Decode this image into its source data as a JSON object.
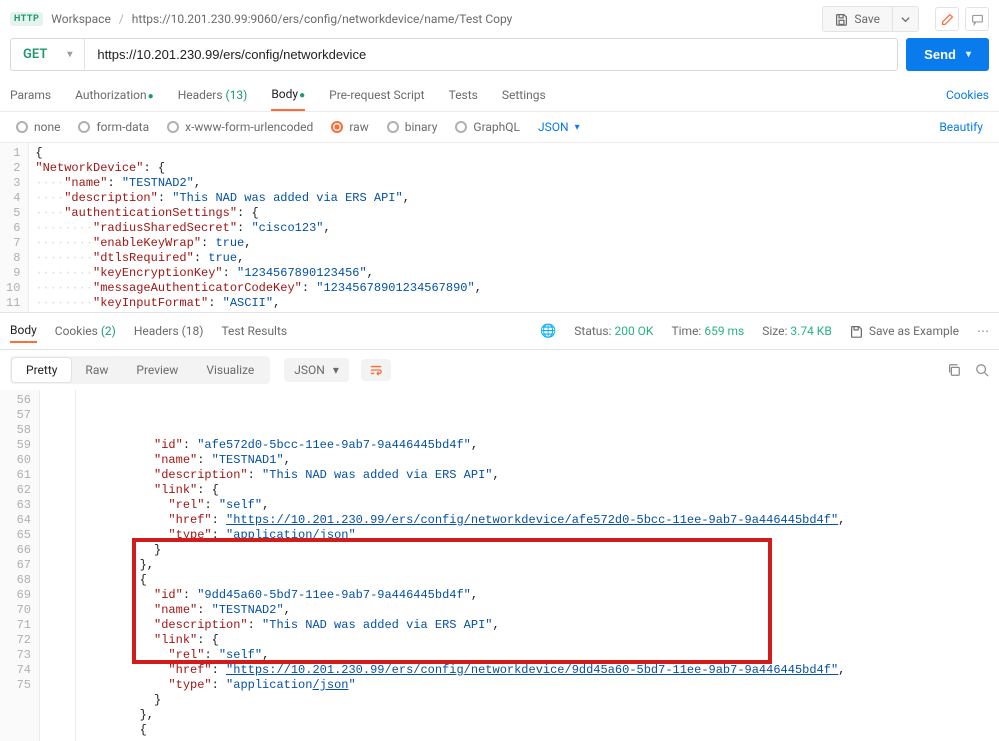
{
  "breadcrumb": {
    "workspace": "Workspace",
    "title": "https://10.201.230.99:9060/ers/config/networkdevice/name/Test Copy"
  },
  "save_button": {
    "label": "Save"
  },
  "request": {
    "method": "GET",
    "url": "https://10.201.230.99/ers/config/networkdevice"
  },
  "send_button": {
    "label": "Send"
  },
  "req_tabs": {
    "params": "Params",
    "auth": "Authorization",
    "headers": "Headers",
    "headers_count": "(13)",
    "body": "Body",
    "prereq": "Pre-request Script",
    "tests": "Tests",
    "settings": "Settings",
    "cookies": "Cookies"
  },
  "body_types": {
    "none": "none",
    "form_data": "form-data",
    "x_www": "x-www-form-urlencoded",
    "raw": "raw",
    "binary": "binary",
    "graphql": "GraphQL",
    "lang": "JSON",
    "beautify": "Beautify"
  },
  "request_body_lines": [
    "{",
    "\"NetworkDevice\": {",
    "····\"name\": \"TESTNAD2\",",
    "····\"description\": \"This NAD was added via ERS API\",",
    "····\"authenticationSettings\": {",
    "········\"radiusSharedSecret\": \"cisco123\",",
    "········\"enableKeyWrap\": true,",
    "········\"dtlsRequired\": true,",
    "········\"keyEncryptionKey\": \"1234567890123456\",",
    "········\"messageAuthenticatorCodeKey\": \"12345678901234567890\",",
    "········\"keyInputFormat\": \"ASCII\","
  ],
  "response_status": {
    "status_label": "Status:",
    "status_value": "200 OK",
    "time_label": "Time:",
    "time_value": "659 ms",
    "size_label": "Size:",
    "size_value": "3.74 KB",
    "save_example": "Save as Example"
  },
  "resp_tabs": {
    "body": "Body",
    "cookies": "Cookies",
    "cookies_count": "(2)",
    "headers": "Headers",
    "headers_count": "(18)",
    "tests": "Test Results"
  },
  "view_modes": {
    "pretty": "Pretty",
    "raw": "Raw",
    "preview": "Preview",
    "visualize": "Visualize",
    "lang": "JSON"
  },
  "response_lines": {
    "start": 56,
    "lines": [
      {
        "indent": 10,
        "parts": [
          [
            "key",
            "\"id\""
          ],
          [
            "punc",
            ": "
          ],
          [
            "str",
            "\"afe572d0-5bcc-11ee-9ab7-9a446445bd4f\""
          ],
          [
            "punc",
            ","
          ]
        ]
      },
      {
        "indent": 10,
        "parts": [
          [
            "key",
            "\"name\""
          ],
          [
            "punc",
            ": "
          ],
          [
            "str",
            "\"TESTNAD1\""
          ],
          [
            "punc",
            ","
          ]
        ]
      },
      {
        "indent": 10,
        "parts": [
          [
            "key",
            "\"description\""
          ],
          [
            "punc",
            ": "
          ],
          [
            "str",
            "\"This NAD was added via ERS API\""
          ],
          [
            "punc",
            ","
          ]
        ]
      },
      {
        "indent": 10,
        "parts": [
          [
            "key",
            "\"link\""
          ],
          [
            "punc",
            ": {"
          ]
        ]
      },
      {
        "indent": 12,
        "parts": [
          [
            "key",
            "\"rel\""
          ],
          [
            "punc",
            ": "
          ],
          [
            "str",
            "\"self\""
          ],
          [
            "punc",
            ","
          ]
        ]
      },
      {
        "indent": 12,
        "parts": [
          [
            "key",
            "\"href\""
          ],
          [
            "punc",
            ": "
          ],
          [
            "strlink",
            "\"https://10.201.230.99/ers/config/networkdevice/afe572d0-5bcc-11ee-9ab7-9a446445bd4f\""
          ],
          [
            "punc",
            ","
          ]
        ]
      },
      {
        "indent": 12,
        "parts": [
          [
            "key",
            "\"type\""
          ],
          [
            "punc",
            ": "
          ],
          [
            "strpart",
            "\"application"
          ],
          [
            "strlink",
            "/json"
          ],
          [
            "strpart",
            "\""
          ]
        ]
      },
      {
        "indent": 10,
        "parts": [
          [
            "punc",
            "}"
          ]
        ]
      },
      {
        "indent": 8,
        "parts": [
          [
            "punc",
            "},"
          ]
        ]
      },
      {
        "indent": 8,
        "parts": [
          [
            "punc",
            "{"
          ]
        ]
      },
      {
        "indent": 10,
        "parts": [
          [
            "key",
            "\"id\""
          ],
          [
            "punc",
            ": "
          ],
          [
            "str",
            "\"9dd45a60-5bd7-11ee-9ab7-9a446445bd4f\""
          ],
          [
            "punc",
            ","
          ]
        ]
      },
      {
        "indent": 10,
        "parts": [
          [
            "key",
            "\"name\""
          ],
          [
            "punc",
            ": "
          ],
          [
            "str",
            "\"TESTNAD2\""
          ],
          [
            "punc",
            ","
          ]
        ]
      },
      {
        "indent": 10,
        "parts": [
          [
            "key",
            "\"description\""
          ],
          [
            "punc",
            ": "
          ],
          [
            "str",
            "\"This NAD was added via ERS API\""
          ],
          [
            "punc",
            ","
          ]
        ]
      },
      {
        "indent": 10,
        "parts": [
          [
            "key",
            "\"link\""
          ],
          [
            "punc",
            ": {"
          ]
        ]
      },
      {
        "indent": 12,
        "parts": [
          [
            "key",
            "\"rel\""
          ],
          [
            "punc",
            ": "
          ],
          [
            "str",
            "\"self\""
          ],
          [
            "punc",
            ","
          ]
        ]
      },
      {
        "indent": 12,
        "parts": [
          [
            "key",
            "\"href\""
          ],
          [
            "punc",
            ": "
          ],
          [
            "strlink",
            "\"https://10.201.230.99/ers/config/networkdevice/9dd45a60-5bd7-11ee-9ab7-9a446445bd4f\""
          ],
          [
            "punc",
            ","
          ]
        ]
      },
      {
        "indent": 12,
        "parts": [
          [
            "key",
            "\"type\""
          ],
          [
            "punc",
            ": "
          ],
          [
            "strpart",
            "\"application"
          ],
          [
            "strlink",
            "/json"
          ],
          [
            "strpart",
            "\""
          ]
        ]
      },
      {
        "indent": 10,
        "parts": [
          [
            "punc",
            "}"
          ]
        ]
      },
      {
        "indent": 8,
        "parts": [
          [
            "punc",
            "},"
          ]
        ]
      },
      {
        "indent": 8,
        "parts": [
          [
            "punc",
            "{"
          ]
        ]
      }
    ]
  },
  "highlight_box": {
    "top_line_index": 10,
    "bottom_line_index": 17
  }
}
